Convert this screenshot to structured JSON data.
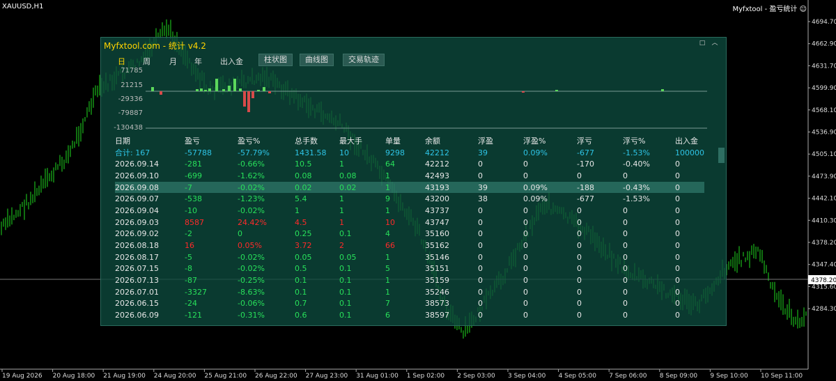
{
  "window": {
    "symbol": "XAUUSD,H1",
    "indicator": "Myfxtool - 盈亏统计 ☺"
  },
  "price_axis": [
    "4694.70",
    "4662.90",
    "4631.70",
    "4599.90",
    "4568.10",
    "4536.90",
    "4505.10",
    "4473.90",
    "4442.10",
    "4410.30",
    "4378.20",
    "4347.40",
    "4315.60",
    "4284.30"
  ],
  "time_axis": [
    "19 Aug 2026",
    "20 Aug 18:00",
    "21 Aug 19:00",
    "24 Aug 20:00",
    "25 Aug 21:00",
    "26 Aug 22:00",
    "27 Aug 23:00",
    "31 Aug 01:00",
    "1 Sep 02:00",
    "2 Sep 03:00",
    "3 Sep 04:00",
    "4 Sep 05:00",
    "7 Sep 06:00",
    "8 Sep 09:00",
    "9 Sep 10:00",
    "10 Sep 11:00"
  ],
  "panel": {
    "title": "Myfxtool.com - 统计  v4.2",
    "minimize": "□",
    "collapse": "︿",
    "tabs": [
      "日",
      "周",
      "月",
      "年",
      "出入金"
    ],
    "view_buttons": [
      "柱状图",
      "曲线图",
      "交易轨迹"
    ],
    "y_labels": [
      "71785",
      "21215",
      "-29336",
      "-79887",
      "-130438"
    ],
    "headers": [
      "日期",
      "盈亏",
      "盈亏%",
      "总手数",
      "最大手",
      "单量",
      "余额",
      "浮盈",
      "浮盈%",
      "浮亏",
      "浮亏%",
      "出入金"
    ],
    "total": [
      "合计: 167",
      "-57788",
      "-57.79%",
      "1431.58",
      "10",
      "9298",
      "42212",
      "39",
      "0.09%",
      "-677",
      "-1.53%",
      "100000"
    ],
    "rows": [
      [
        "2026.09.14",
        "-281",
        "-0.66%",
        "10.5",
        "1",
        "64",
        "42212",
        "0",
        "0",
        "-170",
        "-0.40%",
        "0"
      ],
      [
        "2026.09.10",
        "-699",
        "-1.62%",
        "0.08",
        "0.08",
        "1",
        "42493",
        "0",
        "0",
        "0",
        "0",
        "0"
      ],
      [
        "2026.09.08",
        "-7",
        "-0.02%",
        "0.02",
        "0.02",
        "1",
        "43193",
        "39",
        "0.09%",
        "-188",
        "-0.43%",
        "0"
      ],
      [
        "2026.09.07",
        "-538",
        "-1.23%",
        "5.4",
        "1",
        "9",
        "43200",
        "38",
        "0.09%",
        "-677",
        "-1.53%",
        "0"
      ],
      [
        "2026.09.04",
        "-10",
        "-0.02%",
        "1",
        "1",
        "1",
        "43737",
        "0",
        "0",
        "0",
        "0",
        "0"
      ],
      [
        "2026.09.03",
        "8587",
        "24.42%",
        "4.5",
        "1",
        "10",
        "43747",
        "0",
        "0",
        "0",
        "0",
        "0"
      ],
      [
        "2026.09.02",
        "-2",
        "0",
        "0.25",
        "0.1",
        "4",
        "35160",
        "0",
        "0",
        "0",
        "0",
        "0"
      ],
      [
        "2026.08.18",
        "16",
        "0.05%",
        "3.72",
        "2",
        "66",
        "35162",
        "0",
        "0",
        "0",
        "0",
        "0"
      ],
      [
        "2026.08.17",
        "-5",
        "-0.02%",
        "0.05",
        "0.05",
        "1",
        "35146",
        "0",
        "0",
        "0",
        "0",
        "0"
      ],
      [
        "2026.07.15",
        "-8",
        "-0.02%",
        "0.5",
        "0.1",
        "5",
        "35151",
        "0",
        "0",
        "0",
        "0",
        "0"
      ],
      [
        "2026.07.13",
        "-87",
        "-0.25%",
        "0.1",
        "0.1",
        "1",
        "35159",
        "0",
        "0",
        "0",
        "0",
        "0"
      ],
      [
        "2026.07.01",
        "-3327",
        "-8.63%",
        "0.1",
        "0.1",
        "1",
        "35246",
        "0",
        "0",
        "0",
        "0",
        "0"
      ],
      [
        "2026.06.15",
        "-24",
        "-0.06%",
        "0.7",
        "0.1",
        "7",
        "38573",
        "0",
        "0",
        "0",
        "0",
        "0"
      ],
      [
        "2026.06.09",
        "-121",
        "-0.31%",
        "0.6",
        "0.1",
        "6",
        "38597",
        "0",
        "0",
        "0",
        "0",
        "0"
      ]
    ],
    "row_colors": [
      "g",
      "g",
      "g",
      "g",
      "g",
      "r",
      "g",
      "r",
      "g",
      "g",
      "g",
      "g",
      "g",
      "g"
    ],
    "selected_row": 2
  }
}
